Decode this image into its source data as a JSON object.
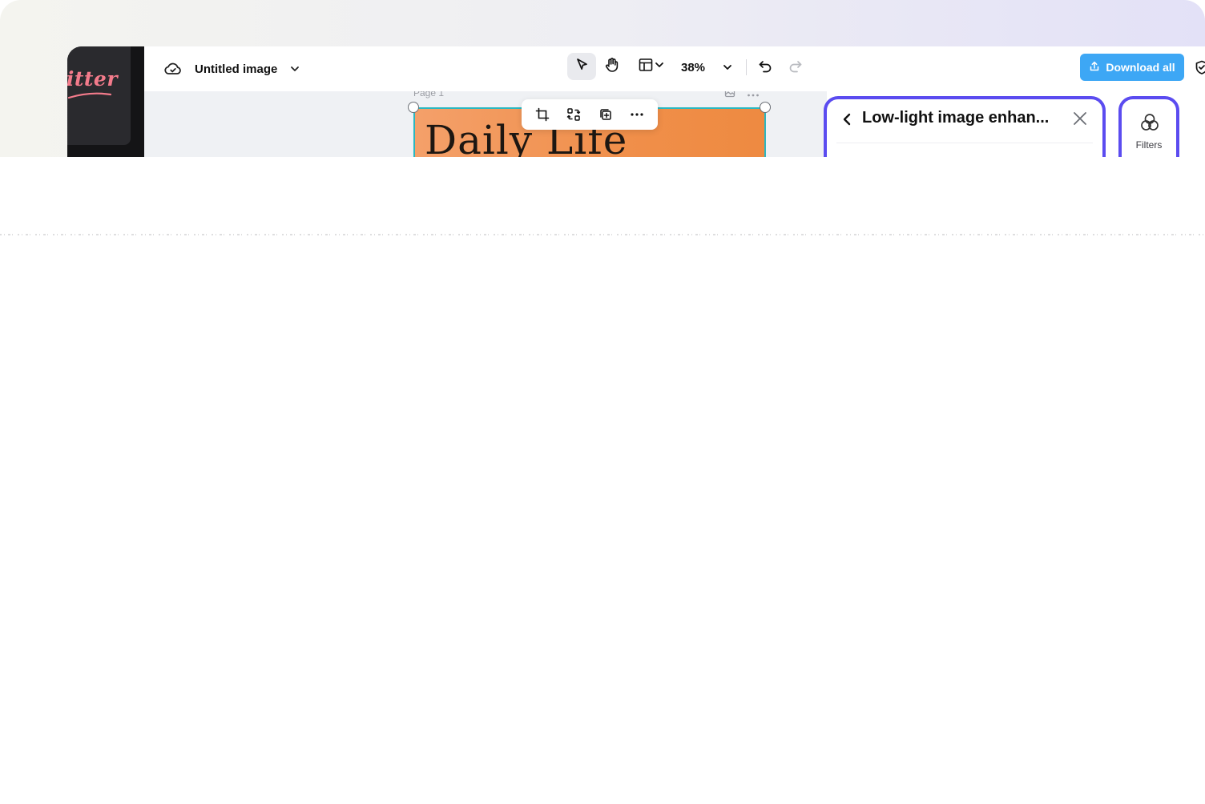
{
  "window": {
    "document_title": "Untitled image",
    "zoom_level": "38%",
    "download_label": "Download all"
  },
  "rail": {
    "thumbnail_text": "sitter"
  },
  "canvas": {
    "page_label": "Page 1",
    "design_title": "Daily Life"
  },
  "panel": {
    "title": "Low-light image enhan...",
    "filters_label": "Filters"
  },
  "colors": {
    "accent_panel_border": "#5b4cf0",
    "download_button": "#3da7f5",
    "selection_border": "#2bb7c0",
    "design_orange": "#f08f4a",
    "thumb_pink": "#f37b8b"
  },
  "icons": {
    "cloud": "cloud-check-icon",
    "select": "cursor-arrow-icon",
    "hand": "hand-pan-icon",
    "layout": "layout-icon",
    "undo": "undo-icon",
    "redo": "redo-icon",
    "crop": "crop-icon",
    "replace": "replace-image-icon",
    "duplicate": "duplicate-icon",
    "more": "more-dots-icon",
    "back": "chevron-left-icon",
    "close": "close-icon",
    "filters": "filters-circles-icon",
    "share": "share-upload-icon",
    "shield": "shield-icon"
  }
}
